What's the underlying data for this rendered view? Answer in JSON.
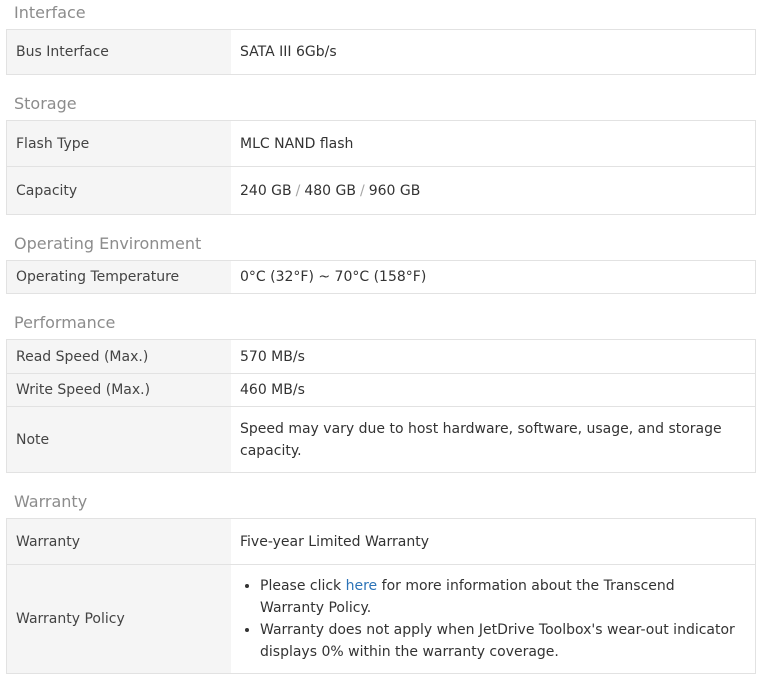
{
  "sections": {
    "interface": {
      "title": "Interface",
      "rows": [
        {
          "label": "Bus Interface",
          "value": "SATA III 6Gb/s"
        }
      ]
    },
    "storage": {
      "title": "Storage",
      "rows": [
        {
          "label": "Flash Type",
          "value": "MLC NAND flash"
        },
        {
          "label": "Capacity",
          "values": [
            "240 GB",
            "480 GB",
            "960 GB"
          ],
          "separator": "/"
        }
      ]
    },
    "environment": {
      "title": "Operating Environment",
      "rows": [
        {
          "label": "Operating Temperature",
          "value": "0°C (32°F) ~ 70°C (158°F)"
        }
      ]
    },
    "performance": {
      "title": "Performance",
      "rows": [
        {
          "label": "Read Speed (Max.)",
          "value": "570 MB/s"
        },
        {
          "label": "Write Speed (Max.)",
          "value": "460 MB/s"
        },
        {
          "label": "Note",
          "value": "Speed may vary due to host hardware, software, usage, and storage capacity."
        }
      ]
    },
    "warranty": {
      "title": "Warranty",
      "rows": [
        {
          "label": "Warranty",
          "value": "Five-year Limited Warranty"
        },
        {
          "label": "Warranty Policy",
          "bullet1_before": "Please click ",
          "bullet1_link": "here",
          "bullet1_after": " for more information about the Transcend Warranty Policy.",
          "bullet2": "Warranty does not apply when JetDrive Toolbox's wear-out indicator displays 0% within the warranty coverage."
        }
      ]
    }
  },
  "colors": {
    "link": "#2c73b7",
    "section_title": "#8c8c8c",
    "label_bg": "#f5f5f5",
    "border": "#e2e2e2"
  }
}
